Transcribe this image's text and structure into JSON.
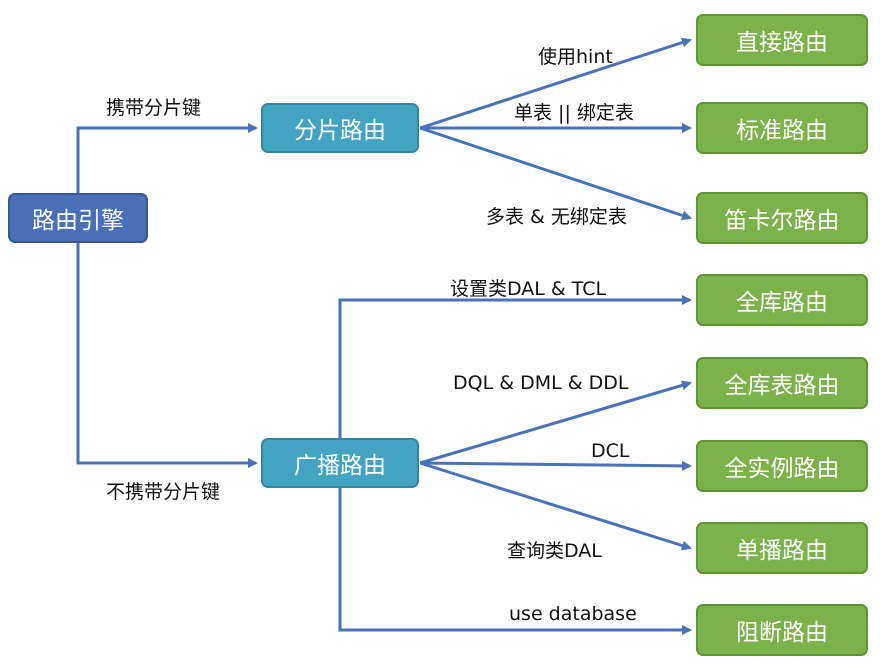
{
  "nodes": {
    "engine": "路由引擎",
    "sharding": "分片路由",
    "broadcast": "广播路由",
    "direct": "直接路由",
    "standard": "标准路由",
    "cartesian": "笛卡尔路由",
    "all_db": "全库路由",
    "all_db_table": "全库表路由",
    "all_instance": "全实例路由",
    "unicast": "单播路由",
    "block": "阻断路由"
  },
  "edge_labels": {
    "with_shard_key": "携带分片键",
    "without_shard_key": "不携带分片键",
    "use_hint": "使用hint",
    "single_or_binding": "单表 || 绑定表",
    "multi_no_binding": "多表 & 无绑定表",
    "set_dal_tcl": "设置类DAL & TCL",
    "dql_dml_ddl": "DQL & DML & DDL",
    "dcl": "DCL",
    "query_dal": "查询类DAL",
    "use_database": "use database"
  },
  "colors": {
    "root": "#4a6fb8",
    "middle": "#42a3c2",
    "leaf": "#7bb24a",
    "connector": "#4a72b8"
  }
}
